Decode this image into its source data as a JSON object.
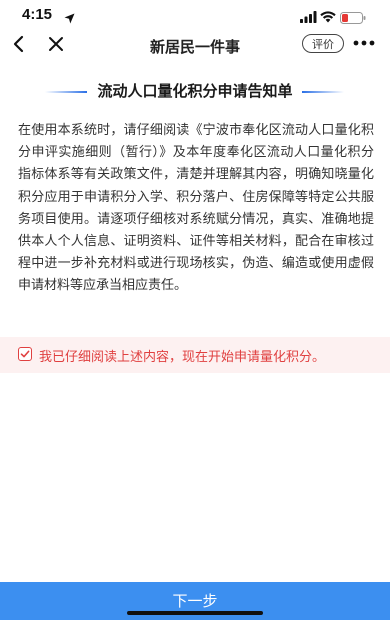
{
  "status_bar": {
    "time": "4:15",
    "location_icon": "location-arrow-icon",
    "signal_icon": "signal-icon",
    "wifi_icon": "wifi-icon",
    "battery_icon": "battery-icon",
    "battery_color": "#e53935"
  },
  "nav": {
    "back_icon": "chevron-left-icon",
    "close_icon": "close-icon",
    "title": "新居民一件事",
    "rate_label": "评价",
    "more_icon": "more-icon"
  },
  "notice": {
    "title": "流动人口量化积分申请告知单",
    "accent_color": "#2a6fe6",
    "body": "在使用本系统时，请仔细阅读《宁波市奉化区流动人口量化积分申评实施细则（暂行）》及本年度奉化区流动人口量化积分指标体系等有关政策文件，清楚并理解其内容，明确知晓量化积分应用于申请积分入学、积分落户、住房保障等特定公共服务项目使用。请逐项仔细核对系统赋分情况，真实、准确地提供本人个人信息、证明资料、证件等相关材料，配合在审核过程中进一步补充材料或进行现场核实，伪造、编造或使用虚假申请材料等应承当相应责任。"
  },
  "consent": {
    "checked": true,
    "checkbox_icon": "checkbox-checked-icon",
    "text": "我已仔细阅读上述内容，现在开始申请量化积分。",
    "color": "#e04040",
    "background": "#fdf1f1"
  },
  "footer": {
    "next_label": "下一步",
    "button_color": "#3c8ff0"
  }
}
